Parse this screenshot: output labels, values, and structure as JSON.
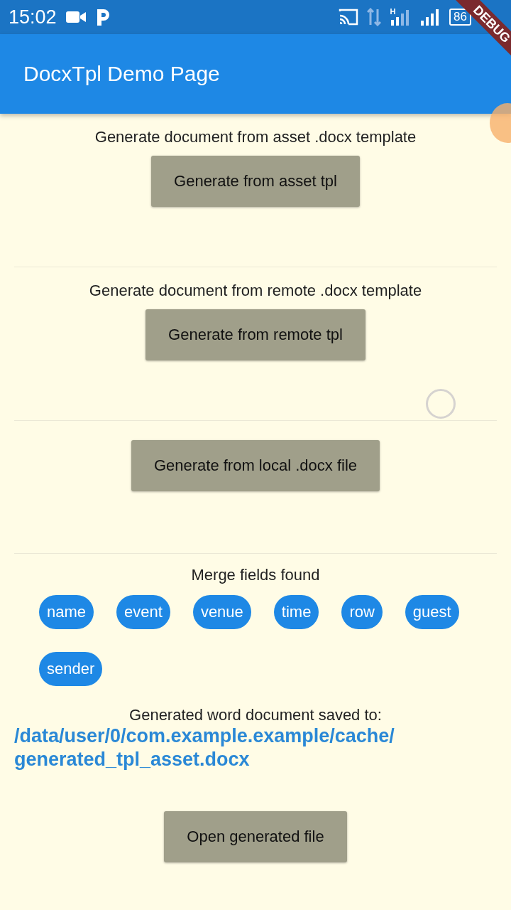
{
  "status_bar": {
    "time": "15:02",
    "battery": "86"
  },
  "app_bar": {
    "title": "DocxTpl Demo Page"
  },
  "debug_banner": "DEBUG",
  "sections": [
    {
      "label": "Generate document from asset .docx template",
      "button": "Generate from asset tpl"
    },
    {
      "label": "Generate document from remote .docx template",
      "button": "Generate from remote tpl"
    },
    {
      "button": "Generate from local .docx file"
    }
  ],
  "merge_fields": {
    "title": "Merge fields found",
    "chips": [
      "name",
      "event",
      "venue",
      "time",
      "row",
      "guest",
      "sender"
    ]
  },
  "output": {
    "caption": "Generated word document saved to:",
    "path": "/data/user/0/com.example.example/cache/ generated_tpl_asset.docx"
  },
  "open_button": "Open generated file"
}
